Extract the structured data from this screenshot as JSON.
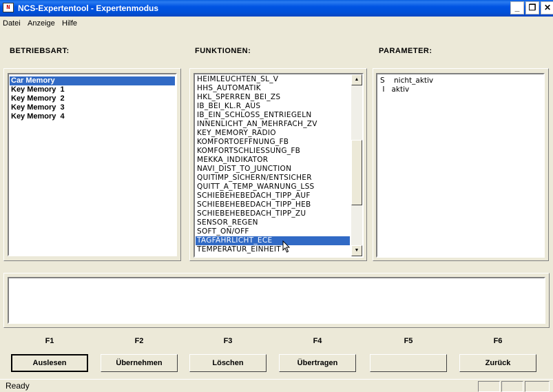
{
  "window": {
    "title": "NCS-Expertentool - Expertenmodus",
    "icon_label": "N",
    "controls": {
      "minimize": "_",
      "maximize": "❐",
      "close": "✕"
    }
  },
  "menu": [
    "Datei",
    "Anzeige",
    "Hilfe"
  ],
  "sections": {
    "betriebsart": "BETRIEBSART:",
    "funktionen": "FUNKTIONEN:",
    "parameter": "PARAMETER:"
  },
  "betriebsart_items": [
    "Car Memory",
    "Key Memory  1",
    "Key Memory  2",
    "Key Memory  3",
    "Key Memory  4"
  ],
  "betriebsart_selected": 0,
  "funktionen_items": [
    "HEIMLEUCHTEN_SL_V",
    "HHS_AUTOMATIK",
    "HKL_SPERREN_BEI_ZS",
    "IB_BEI_KL.R_AUS",
    "IB_EIN_SCHLOSS_ENTRIEGELN",
    "INNENLICHT_AN_MEHRFACH_ZV",
    "KEY_MEMORY_RADIO",
    "KOMFORTOEFFNUNG_FB",
    "KOMFORTSCHLIESSUNG_FB",
    "MEKKA_INDIKATOR",
    "NAVI_DIST_TO_JUNCTION",
    "QUITIMP_SICHERN/ENTSICHER",
    "QUITT_A_TEMP_WARNUNG_LSS",
    "SCHIEBEHEBEDACH_TIPP_AUF",
    "SCHIEBEHEBEDACH_TIPP_HEB",
    "SCHIEBEHEBEDACH_TIPP_ZU",
    "SENSOR_REGEN",
    "SOFT_ON/OFF",
    "TAGFAHRLICHT_ECE",
    "TEMPERATUR_EINHEIT"
  ],
  "funktionen_selected": 18,
  "funktionen_scroll_fraction": 0.58,
  "parameter_items": [
    "S    nicht_aktiv",
    " I   aktiv"
  ],
  "fkeys": [
    "F1",
    "F2",
    "F3",
    "F4",
    "F5",
    "F6"
  ],
  "buttons": [
    "Auslesen",
    "Übernehmen",
    "Löschen",
    "Übertragen",
    "",
    "Zurück"
  ],
  "status": "Ready",
  "colors": {
    "selection": "#316ac5",
    "titlebar": "#0054e3",
    "face": "#ece9d8"
  }
}
